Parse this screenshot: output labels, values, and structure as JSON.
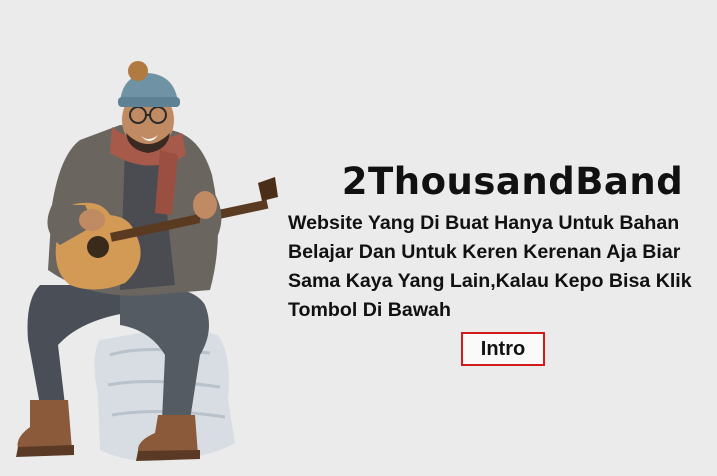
{
  "site": {
    "title": "2ThousandBand",
    "description": "Website Yang Di Buat Hanya Untuk Bahan\nBelajar Dan Untuk Keren Kerenan Aja Biar\nSama Kaya Yang Lain,Kalau Kepo Bisa Klik\nTombol Di Bawah",
    "intro_label": "Intro"
  },
  "image": {
    "icon": "guitarist-illustration"
  }
}
